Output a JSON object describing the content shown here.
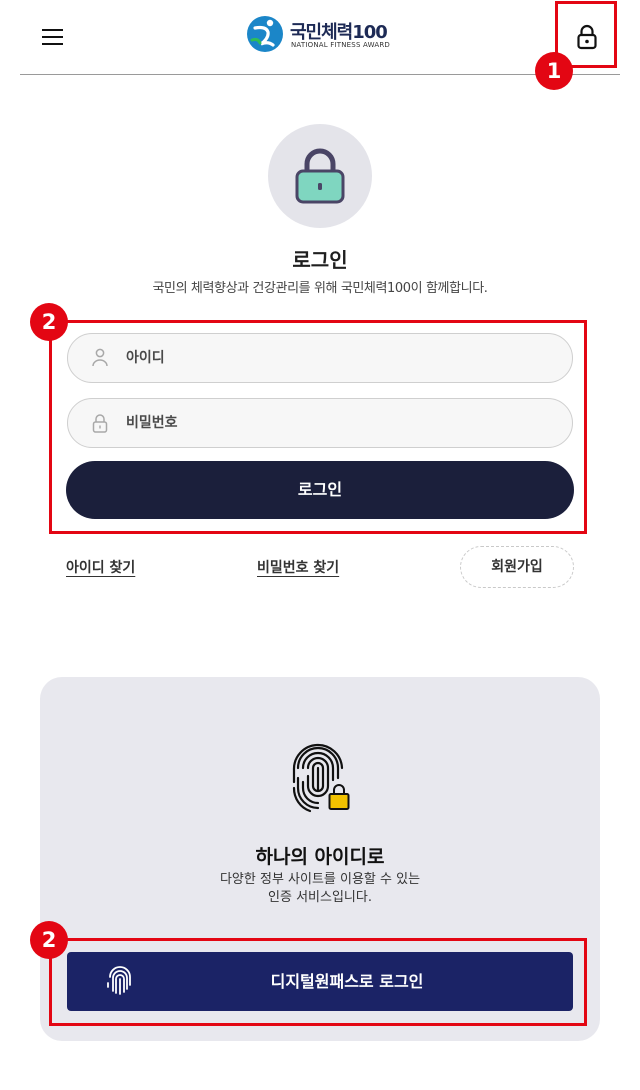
{
  "header": {
    "logo_title": "국민체력100",
    "logo_subtitle": "NATIONAL FITNESS AWARD"
  },
  "login": {
    "title": "로그인",
    "description": "국민의 체력향상과 건강관리를 위해 국민체력100이 함께합니다.",
    "id_placeholder": "아이디",
    "password_placeholder": "비밀번호",
    "submit_label": "로그인"
  },
  "links": {
    "find_id": "아이디 찾기",
    "find_password": "비밀번호 찾기",
    "signup": "회원가입"
  },
  "digital_pass": {
    "title": "하나의 아이디로",
    "desc_line1": "다양한 정부 사이트를 이용할 수 있는",
    "desc_line2": "인증 서비스입니다.",
    "button_label": "디지털원패스로 로그인"
  },
  "annotations": {
    "badge_1": "1",
    "badge_2": "2",
    "badge_3": "2"
  },
  "colors": {
    "annotation_red": "#e30613",
    "login_button": "#1b1f3b",
    "digital_pass_button": "#1b2366",
    "lock_body": "#7fd6c0",
    "dp_lock": "#f2c200"
  },
  "icons": {
    "menu": "hamburger-menu-icon",
    "header_lock": "lock-icon",
    "hero_lock": "lock-icon",
    "user": "user-icon",
    "password": "lock-icon",
    "fingerprint": "fingerprint-lock-icon"
  }
}
